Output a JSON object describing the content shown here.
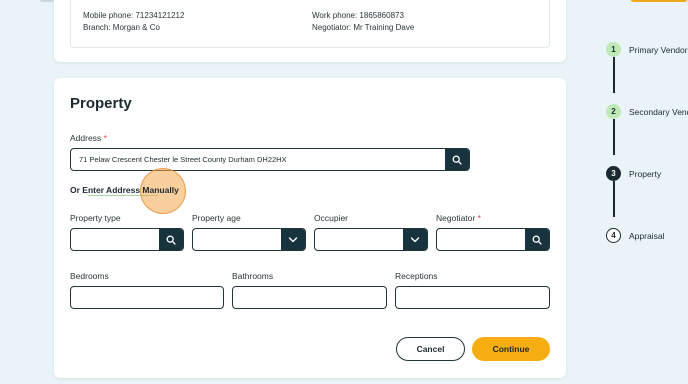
{
  "vendor": {
    "mobile_phone": "Mobile phone: 71234121212",
    "branch": "Branch: Morgan & Co",
    "work_phone": "Work phone: 1865860873",
    "negotiator": "Negotiator: Mr Training Dave"
  },
  "property": {
    "title": "Property",
    "address_label": "Address",
    "required_mark": "*",
    "address_value": "71 Pelaw Crescent  Chester le Street County Durham DH22HX",
    "manual_link": "Or Enter Address Manually",
    "fields": {
      "property_type": "Property type",
      "property_age": "Property age",
      "occupier": "Occupier",
      "negotiator": "Negotiator",
      "bedrooms": "Bedrooms",
      "bathrooms": "Bathrooms",
      "receptions": "Receptions"
    },
    "cancel_label": "Cancel",
    "continue_label": "Continue"
  },
  "steps": [
    {
      "number": "1",
      "label": "Primary Vendor",
      "state": "done"
    },
    {
      "number": "2",
      "label": "Secondary Vendor",
      "state": "done"
    },
    {
      "number": "3",
      "label": "Property",
      "state": "active"
    },
    {
      "number": "4",
      "label": "Appraisal",
      "state": "todo"
    }
  ],
  "colors": {
    "accent": "#f5ad12",
    "dark": "#17333d",
    "step_done": "#bfe9b7",
    "background": "#eaf4f8"
  },
  "icons": {
    "search": "search-icon",
    "dropdown": "chevron-down-icon"
  }
}
